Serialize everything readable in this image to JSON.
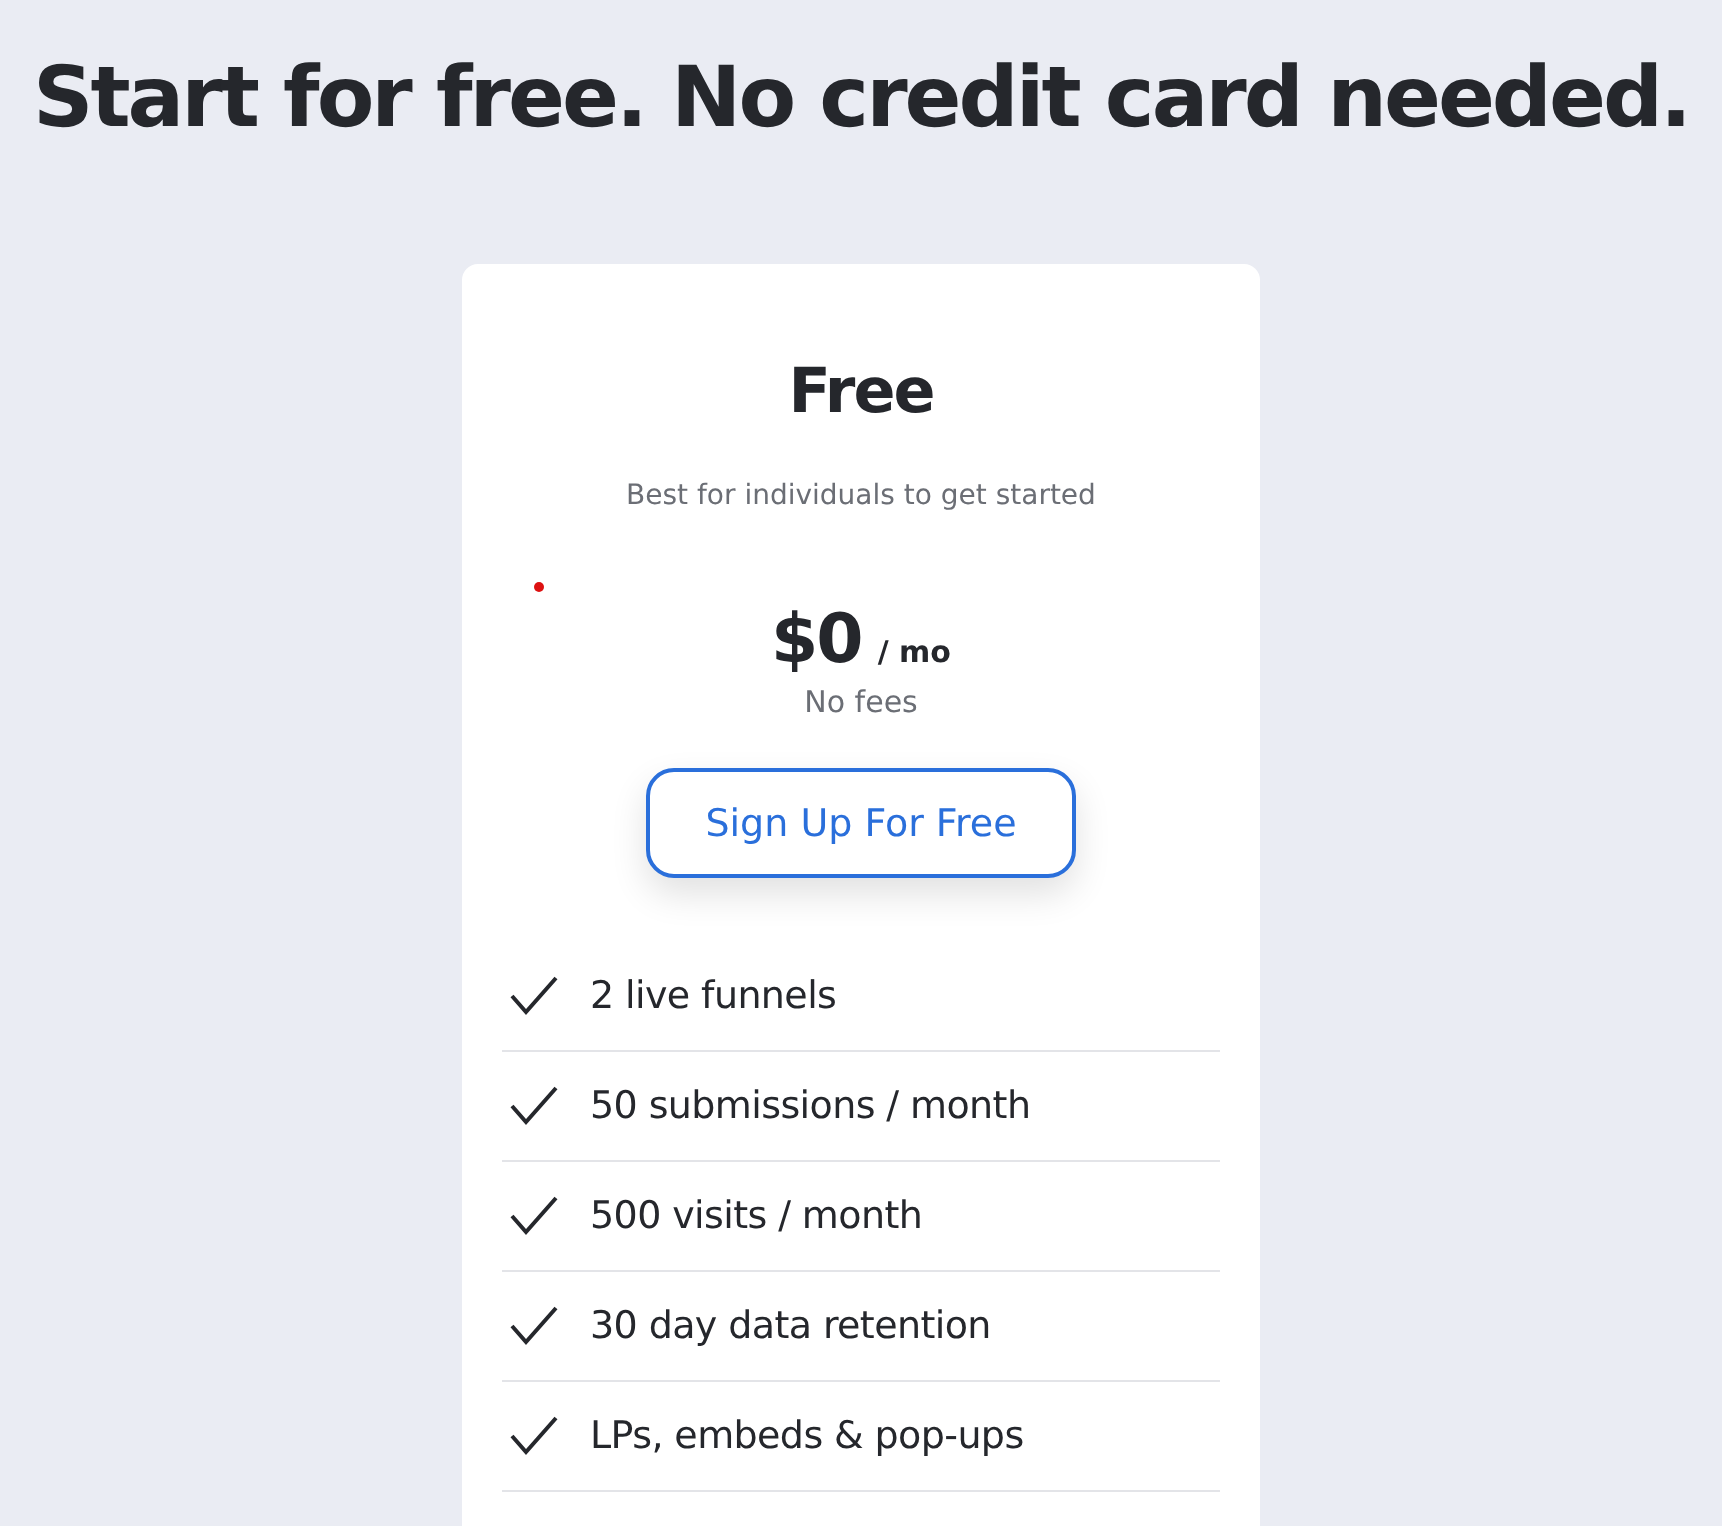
{
  "headline": "Start for free. No credit card needed.",
  "plan": {
    "name": "Free",
    "description": "Best for individuals to get started",
    "price": "$0",
    "period": "/ mo",
    "fee_note": "No fees",
    "button": "Sign Up For Free",
    "features": [
      "2 live funnels",
      "50 submissions / month",
      "500 visits / month",
      "30 day data retention",
      "LPs, embeds & pop-ups"
    ]
  }
}
